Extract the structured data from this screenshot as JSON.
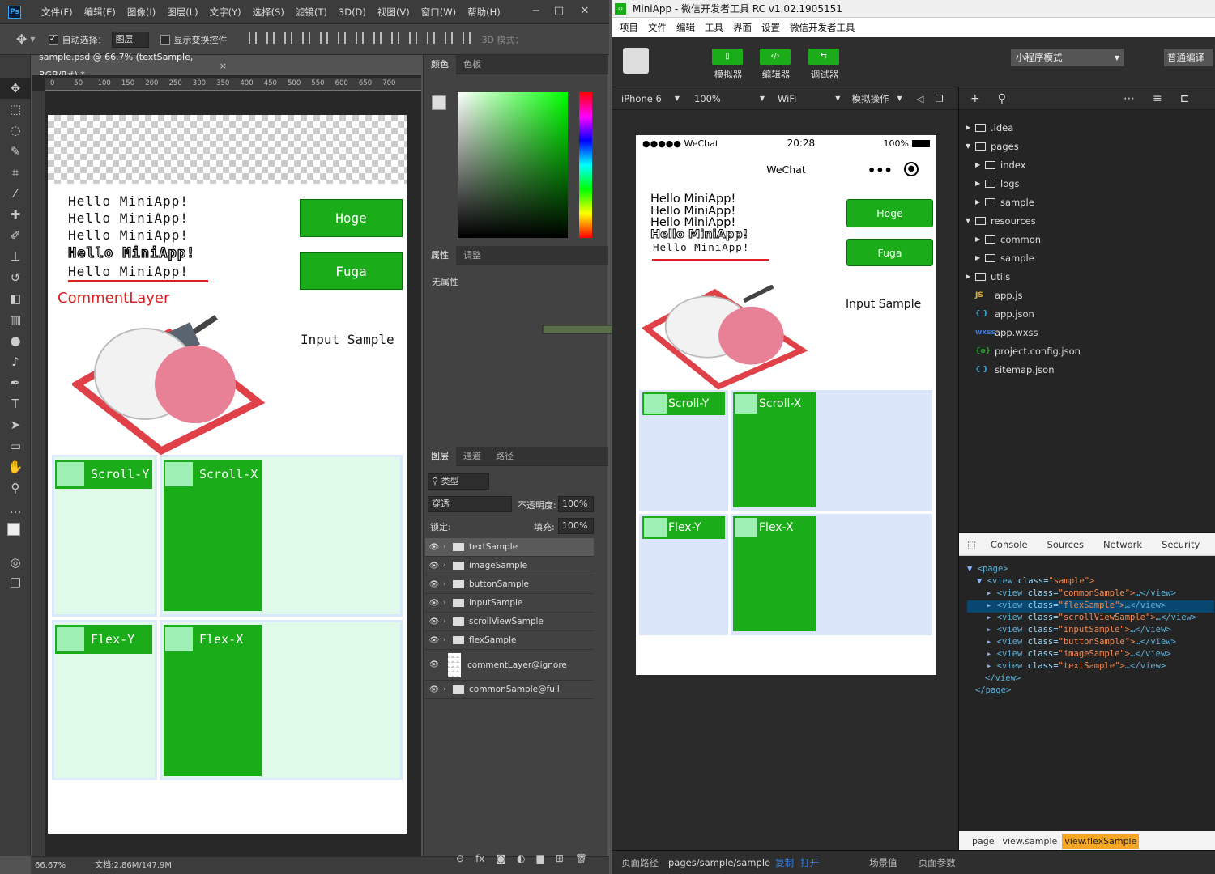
{
  "ps": {
    "menus": [
      "文件(F)",
      "编辑(E)",
      "图像(I)",
      "图层(L)",
      "文字(Y)",
      "选择(S)",
      "滤镜(T)",
      "3D(D)",
      "视图(V)",
      "窗口(W)",
      "帮助(H)"
    ],
    "options": {
      "auto_select": "自动选择：",
      "target": "图层",
      "show_transform": "显示变换控件",
      "mode3d": "3D 模式："
    },
    "doc_tab": "sample.psd @ 66.7% (textSample, RGB/8#) *",
    "ruler": [
      "0",
      "50",
      "100",
      "150",
      "200",
      "250",
      "300",
      "350",
      "400",
      "450",
      "500",
      "550",
      "600",
      "650",
      "700"
    ],
    "hello_lines": [
      "Hello MiniApp!",
      "Hello MiniApp!",
      "Hello MiniApp!",
      "Hello MiniApp!",
      "Hello MiniApp!"
    ],
    "comment_layer": "CommentLayer",
    "buttons": [
      "Hoge",
      "Fuga"
    ],
    "input_sample": "Input Sample",
    "sections": [
      "Scroll-Y",
      "Scroll-X",
      "Flex-Y",
      "Flex-X"
    ],
    "status": {
      "zoom": "66.67%",
      "doc": "文档:2.86M/147.9M"
    },
    "panels": {
      "color_tabs": [
        "颜色",
        "色板"
      ],
      "prop_tabs": [
        "属性",
        "调整"
      ],
      "no_props": "无属性",
      "layer_tabs": [
        "图层",
        "通道",
        "路径"
      ],
      "filter": "类型",
      "blend": "穿透",
      "opacity_label": "不透明度:",
      "opacity": "100%",
      "lock_label": "锁定:",
      "fill_label": "填充:",
      "fill": "100%",
      "layers": [
        "textSample",
        "imageSample",
        "buttonSample",
        "inputSample",
        "scrollViewSample",
        "flexSample",
        "commentLayer@ignore",
        "commonSample@full"
      ]
    }
  },
  "wx": {
    "title": "MiniApp - 微信开发者工具 RC v1.02.1905151",
    "menus": [
      "项目",
      "文件",
      "编辑",
      "工具",
      "界面",
      "设置",
      "微信开发者工具"
    ],
    "tools": [
      "模拟器",
      "编辑器",
      "调试器"
    ],
    "mode": "小程序模式",
    "compile": "普通编译",
    "sim": {
      "device": "iPhone 6",
      "zoom": "100%",
      "net": "WiFi",
      "ops": "模拟操作"
    },
    "phone": {
      "carrier": "●●●●● WeChat",
      "time": "20:28",
      "battery": "100%",
      "nav_title": "WeChat",
      "hello_lines": [
        "Hello MiniApp!",
        "Hello MiniApp!",
        "Hello MiniApp!",
        "Hello MiniApp!",
        "Hello MiniApp!"
      ],
      "buttons": [
        "Hoge",
        "Fuga"
      ],
      "input_sample": "Input Sample",
      "sections": [
        "Scroll-Y",
        "Scroll-X",
        "Flex-Y",
        "Flex-X"
      ]
    },
    "tree": [
      {
        "name": ".idea",
        "type": "folder",
        "depth": 0,
        "caret": "▶"
      },
      {
        "name": "pages",
        "type": "folder",
        "depth": 0,
        "caret": "▼"
      },
      {
        "name": "index",
        "type": "folder",
        "depth": 1,
        "caret": "▶"
      },
      {
        "name": "logs",
        "type": "folder",
        "depth": 1,
        "caret": "▶"
      },
      {
        "name": "sample",
        "type": "folder",
        "depth": 1,
        "caret": "▶"
      },
      {
        "name": "resources",
        "type": "folder",
        "depth": 0,
        "caret": "▼"
      },
      {
        "name": "common",
        "type": "folder",
        "depth": 1,
        "caret": "▶"
      },
      {
        "name": "sample",
        "type": "folder",
        "depth": 1,
        "caret": "▶"
      },
      {
        "name": "utils",
        "type": "folder",
        "depth": 0,
        "caret": "▶"
      },
      {
        "name": "app.js",
        "type": "js",
        "depth": 0,
        "caret": ""
      },
      {
        "name": "app.json",
        "type": "json",
        "depth": 0,
        "caret": ""
      },
      {
        "name": "app.wxss",
        "type": "wxss",
        "depth": 0,
        "caret": ""
      },
      {
        "name": "project.config.json",
        "type": "config",
        "depth": 0,
        "caret": ""
      },
      {
        "name": "sitemap.json",
        "type": "json",
        "depth": 0,
        "caret": ""
      }
    ],
    "file_icons": {
      "js": "JS",
      "json": "{ }",
      "wxss": "wxss",
      "config": "{o}"
    },
    "debug_tabs": [
      "Console",
      "Sources",
      "Network",
      "Security"
    ],
    "dom": {
      "page_open": "<page>",
      "view_open_tag": "<view",
      "class_attr": "class=",
      "sample_val": "\"sample\">",
      "children": [
        "commonSample",
        "flexSample",
        "scrollViewSample",
        "inputSample",
        "buttonSample",
        "imageSample",
        "textSample"
      ],
      "ellipsis": "…</view>",
      "view_close": "</view>",
      "page_close": "</page>"
    },
    "crumbs": [
      "page",
      "view.sample",
      "view.flexSample"
    ],
    "bottom": {
      "path_label": "页面路径",
      "path": "pages/sample/sample",
      "copy": "复制",
      "open": "打开",
      "scene": "场景值",
      "params": "页面参数"
    }
  },
  "colors": {
    "green": "#1aad19",
    "light_green": "#9ff0b5",
    "mint": "#e0fbe9",
    "comment_red": "#e02020",
    "section_blue": "#dbe8fb"
  }
}
